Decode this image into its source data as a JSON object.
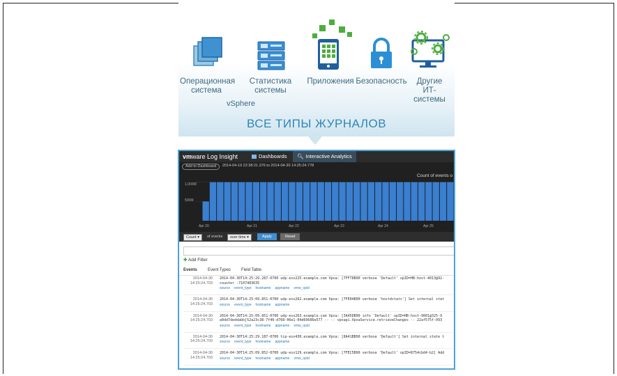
{
  "categories": [
    {
      "line1": "Операционная",
      "line2": "система",
      "icon": "os-layers-icon"
    },
    {
      "line1": "Статистика",
      "line2": "системы",
      "icon": "server-stack-icon"
    },
    {
      "line1": "Приложения",
      "line2": "",
      "icon": "mobile-app-icon"
    },
    {
      "line1": "Безопасность",
      "line2": "",
      "icon": "lock-icon"
    },
    {
      "line1": "Другие",
      "line2": "ИТ-системы",
      "icon": "monitor-gears-icon"
    }
  ],
  "vsphere_label": "vSphere",
  "headline": "ВСЕ ТИПЫ ЖУРНАЛОВ",
  "colors": {
    "accent_blue": "#2f86b8",
    "bar_blue": "#3a7fd0",
    "label_blue": "#3f6a82",
    "green": "#38a036"
  },
  "app": {
    "logo_vm": "vm",
    "logo_rest": "ware Log Insight",
    "tabs": [
      {
        "label": "Dashboards",
        "icon": "dashboard-icon",
        "active": false
      },
      {
        "label": "Interactive Analytics",
        "icon": "search-icon",
        "active": true
      }
    ],
    "add_to_dashboard": "Add to Dashboard",
    "date_range": "2014-04-19 22:38:21.376 to 2014-04-30 14:25:24.778",
    "chart_title": "Count of events o",
    "controls": {
      "count_select": "Count",
      "of_events": "of events",
      "over_time_select": "over time",
      "apply": "Apply",
      "reset": "Reset"
    },
    "add_filter": "Add Filter",
    "result_tabs": [
      "Events",
      "Event Types",
      "Field Table"
    ],
    "field_links_default": [
      "source",
      "event_type",
      "hostname",
      "appname",
      "vmw_opid"
    ],
    "events": [
      {
        "date": "2014-04-30",
        "time": "14:25:24.703",
        "lines": [
          "2014-04-30T14:25:29.287-0700 udp-esx225.example.com Vpxa: [7FF78B90 verbose 'Default' opID=HB-host-4013@92-",
          "counter -7107483635"
        ],
        "fields": [
          "source",
          "event_type",
          "hostname",
          "appname",
          "vmw_opid"
        ]
      },
      {
        "date": "2014-04-30",
        "time": "14:25:24.703",
        "lines": [
          "2014-04-30T14:25:09.851-0700 udp-esx262.example.com Vpxa: [7FE04B90 verbose 'hostdstats'] Set internal stat"
        ],
        "fields": [
          "source",
          "event_type",
          "hostname",
          "appname"
        ]
      },
      {
        "date": "2014-04-30",
        "time": "14:25:24.703",
        "lines": [
          "2014-04-30T14:25:09.851-0700 udp-esx263.example.com Vpxa: [3A45DB90 info 'Default' opID=HB-host-9001@325-9",
          "a0dd7deddabb]52a23c38-7f40-d768-06e1-04d69686e577 -- -- vpxapi.VpxaService.retrieveChanges -- 22af575f-093"
        ],
        "fields": [
          "source",
          "event_type",
          "hostname",
          "appname",
          "vmw_opid"
        ]
      },
      {
        "date": "2014-04-30",
        "time": "14:25:24.703",
        "lines": [
          "2014-04-30T14:25:29.187-0700 tcp-esx430.example.com Vpxa: [8A41BB90 verbose 'Default'] Set internal state t"
        ],
        "fields": [
          "source",
          "event_type",
          "hostname",
          "appname"
        ]
      },
      {
        "date": "2014-04-30",
        "time": "14:25:24.703",
        "lines": [
          "2014-04-30T14:25:09.852-0700 udp-esx129.example.com Vpxa: [7FEC5B90 verbose 'Default' opID=8754cbd4-b2] Add"
        ],
        "fields": [
          "source",
          "event_type",
          "hostname",
          "appname",
          "vmw_opid"
        ]
      }
    ]
  },
  "chart_data": {
    "type": "bar",
    "title": "Count of events o",
    "ylabel": "",
    "xlabel": "",
    "yticks": [
      "1,000M",
      "500M"
    ],
    "xticks": [
      "Apr 20",
      "Apr 21",
      "Apr 22",
      "Apr 23",
      "Apr 24",
      "Apr 25"
    ],
    "ylim": [
      0,
      1300
    ],
    "values": [
      500,
      1000,
      1000,
      1000,
      1000,
      1000,
      1000,
      1000,
      1000,
      1000,
      1000,
      1000,
      1000,
      1000,
      1000,
      1000,
      1000,
      1000,
      1000,
      1000,
      1000,
      1000,
      1000,
      1000,
      1000,
      1000,
      1000,
      1000,
      1000,
      1000,
      1000,
      1000,
      1000,
      1000,
      1000
    ],
    "grid": true
  }
}
